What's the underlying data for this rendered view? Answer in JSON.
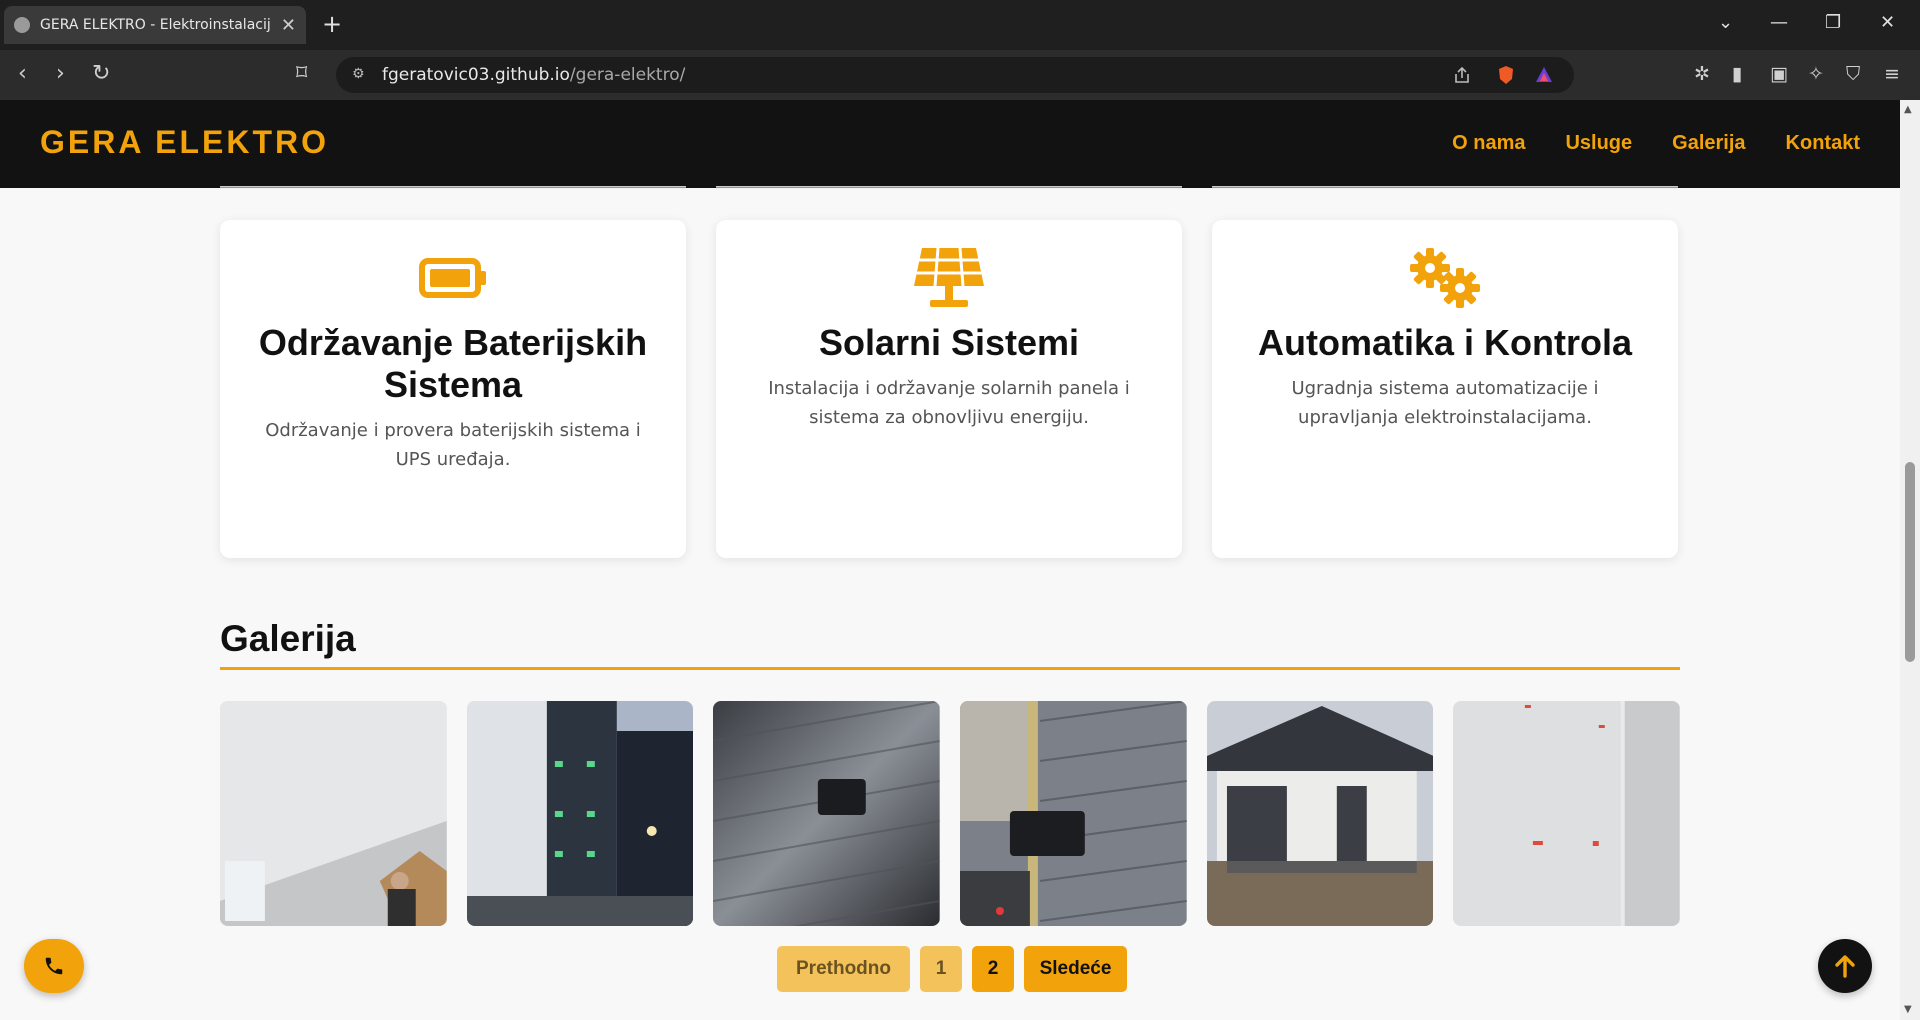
{
  "browser": {
    "tab_title": "GERA ELEKTRO - Elektroinstalacij",
    "url_host": "fgeratovic03.github.io",
    "url_path": "/gera-elektro/"
  },
  "header": {
    "logo": "GERA ELEKTRO",
    "nav": [
      "O nama",
      "Usluge",
      "Galerija",
      "Kontakt"
    ]
  },
  "services": [
    {
      "icon": "battery-icon",
      "title": "Održavanje Baterijskih Sistema",
      "text": "Održavanje i provera baterijskih sistema i UPS uređaja."
    },
    {
      "icon": "solar-panel-icon",
      "title": "Solarni Sistemi",
      "text": "Instalacija i održavanje solarnih panela i sistema za obnovljivu energiju."
    },
    {
      "icon": "gears-icon",
      "title": "Automatika i Kontrola",
      "text": "Ugradnja sistema automatizacije i upravljanja elektroinstalacijama."
    }
  ],
  "gallery": {
    "title": "Galerija",
    "photos": [
      "ceiling-work-photo",
      "building-facade-photo",
      "wall-light-photo",
      "wall-light-dusk-photo",
      "house-exterior-photo",
      "interior-wall-photo"
    ]
  },
  "pagination": {
    "prev": "Prethodno",
    "pages": [
      "1",
      "2"
    ],
    "current": "2",
    "next": "Sledeće"
  },
  "colors": {
    "accent": "#f2a20a",
    "header_bg": "#121212"
  },
  "floating": {
    "call_icon": "phone-icon",
    "top_icon": "arrow-up-icon"
  }
}
